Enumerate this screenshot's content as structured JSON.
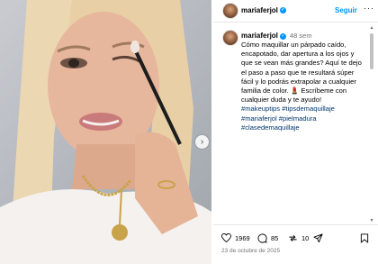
{
  "post": {
    "username": "mariaferjol",
    "follow_label": "Seguir",
    "more_label": "···",
    "time_ago": "48 sem",
    "caption_text": "Cómo maquillar un párpado caído, encapotado, dar apertura a los ojos y que se vean más grandes? Aquí te dejo el paso a paso que te resultará súper fácil y lo podrás extrapolar a cualquier familia de color. 💄 Escríbeme con cualquier duda y te ayudo!",
    "hashtags": [
      "#makeuptips",
      "#tipsdemaquillaje",
      "#mariaferjol",
      "#pielmadura",
      "#clasedemaquillaje"
    ],
    "likes": "1969",
    "comments": "85",
    "shares": "10",
    "date": "23 de octubre de 2025"
  },
  "colors": {
    "accent": "#0095f6",
    "hashtag": "#00376b",
    "muted": "#737373"
  },
  "icons": [
    "verified-badge-icon",
    "heart-icon",
    "comment-icon",
    "share-icon",
    "send-icon",
    "bookmark-icon",
    "chevron-right-icon"
  ]
}
